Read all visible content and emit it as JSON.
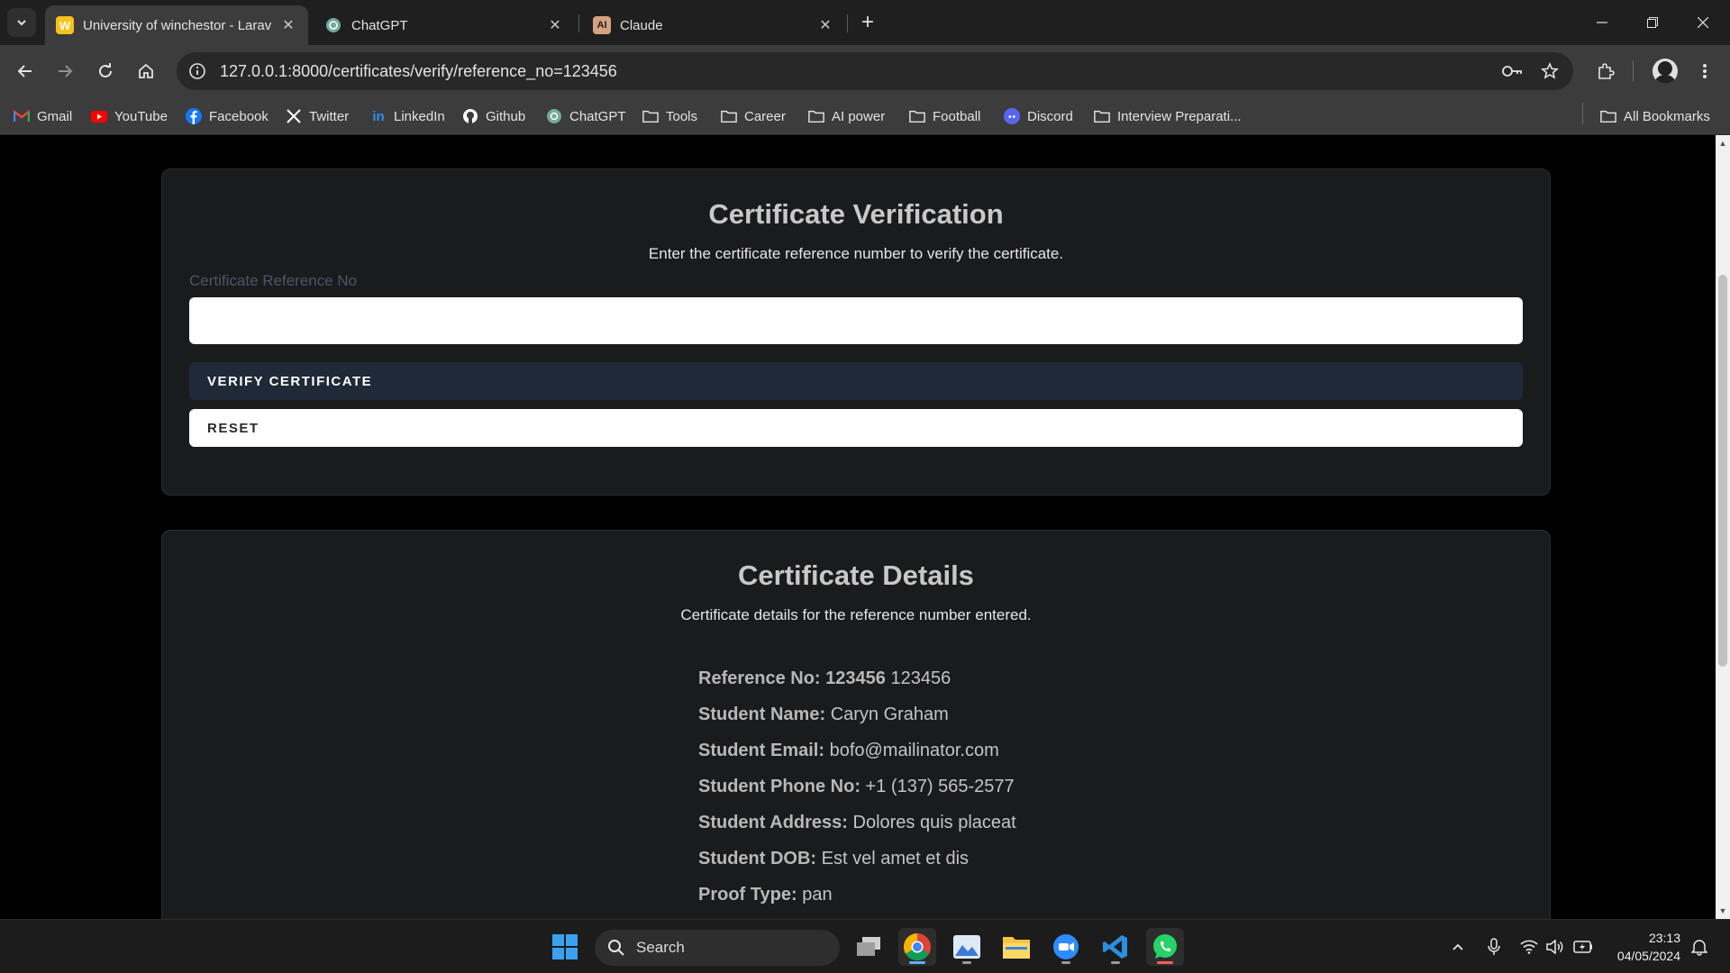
{
  "browser": {
    "tabs": [
      {
        "title": "University of winchestor - Larav",
        "favicon": "W",
        "active": true
      },
      {
        "title": "ChatGPT",
        "favicon": "chatgpt-logo",
        "active": false
      },
      {
        "title": "Claude",
        "favicon": "AI",
        "active": false
      }
    ],
    "url": "127.0.0.1:8000/certificates/verify/reference_no=123456",
    "bookmarks": [
      {
        "label": "Gmail",
        "icon": "gmail-icon"
      },
      {
        "label": "YouTube",
        "icon": "youtube-icon"
      },
      {
        "label": "Facebook",
        "icon": "facebook-icon"
      },
      {
        "label": "Twitter",
        "icon": "x-icon"
      },
      {
        "label": "LinkedIn",
        "icon": "linkedin-icon"
      },
      {
        "label": "Github",
        "icon": "github-icon"
      },
      {
        "label": "ChatGPT",
        "icon": "chatgpt-icon"
      },
      {
        "label": "Tools",
        "icon": "folder-icon"
      },
      {
        "label": "Career",
        "icon": "folder-icon"
      },
      {
        "label": "AI power",
        "icon": "folder-icon"
      },
      {
        "label": "Football",
        "icon": "folder-icon"
      },
      {
        "label": "Discord",
        "icon": "discord-icon"
      },
      {
        "label": "Interview Preparati...",
        "icon": "folder-icon"
      }
    ],
    "all_bookmarks": "All Bookmarks"
  },
  "verification": {
    "title": "Certificate Verification",
    "subtitle": "Enter the certificate reference number to verify the certificate.",
    "field_label": "Certificate Reference No",
    "field_value": "",
    "verify_button": "VERIFY CERTIFICATE",
    "reset_button": "RESET"
  },
  "details": {
    "title": "Certificate Details",
    "subtitle": "Certificate details for the reference number entered.",
    "rows": [
      {
        "key": "Reference No:",
        "keyValue": "123456",
        "value": "123456"
      },
      {
        "key": "Student Name:",
        "value": "Caryn Graham"
      },
      {
        "key": "Student Email:",
        "value": "bofo@mailinator.com"
      },
      {
        "key": "Student Phone No:",
        "value": "+1 (137) 565-2577"
      },
      {
        "key": "Student Address:",
        "value": "Dolores quis placeat"
      },
      {
        "key": "Student DOB:",
        "value": "Est vel amet et dis"
      },
      {
        "key": "Proof Type:",
        "value": "pan"
      }
    ]
  },
  "taskbar": {
    "search_label": "Search",
    "time": "23:13",
    "date": "04/05/2024"
  },
  "colors": {
    "page_bg": "#000000",
    "card_bg": "#1a1b1d",
    "verify_button_bg": "#1f2937",
    "accent": "#5fb2f2"
  }
}
